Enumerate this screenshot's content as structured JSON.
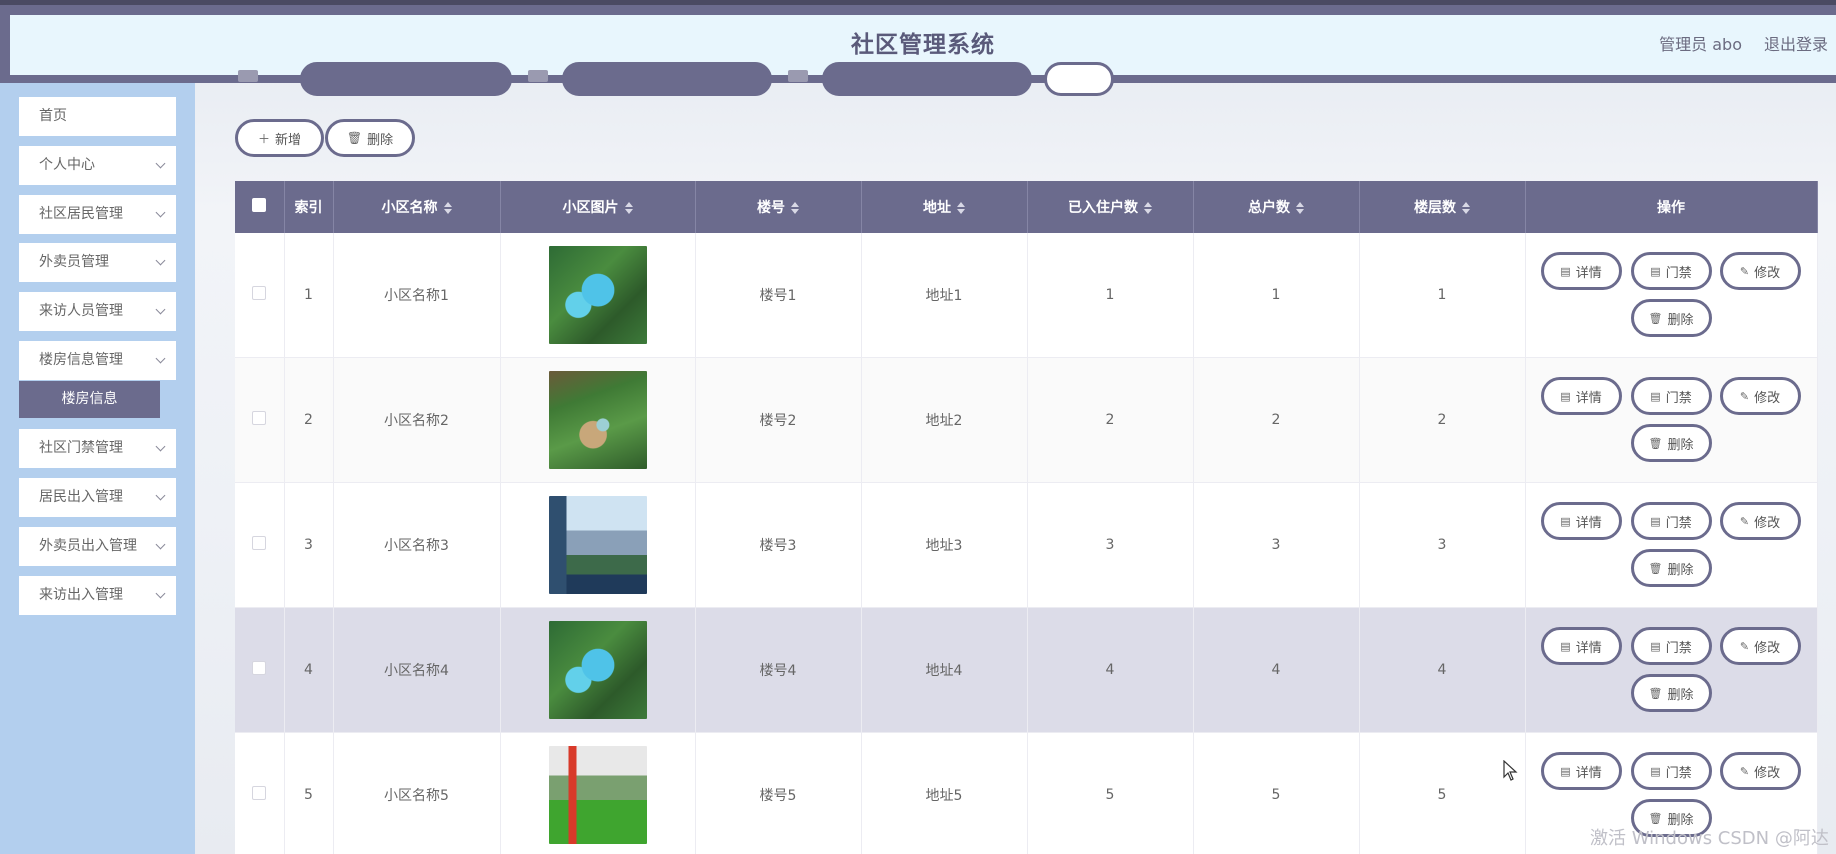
{
  "header": {
    "title": "社区管理系统",
    "user": "管理员 abo",
    "logout": "退出登录"
  },
  "sidebar": {
    "items": [
      "首页",
      "个人中心",
      "社区居民管理",
      "外卖员管理",
      "来访人员管理",
      "楼房信息管理",
      "社区门禁管理",
      "居民出入管理",
      "外卖员出入管理",
      "来访出入管理"
    ],
    "active_sub": "楼房信息"
  },
  "toolbar": {
    "add": "新增",
    "delete": "删除"
  },
  "table": {
    "headers": [
      "索引",
      "小区名称",
      "小区图片",
      "楼号",
      "地址",
      "已入住户数",
      "总户数",
      "楼层数",
      "操作"
    ],
    "rows": [
      {
        "index": "1",
        "name": "小区名称1",
        "building": "楼号1",
        "address": "地址1",
        "occupied": "1",
        "total": "1",
        "floors": "1"
      },
      {
        "index": "2",
        "name": "小区名称2",
        "building": "楼号2",
        "address": "地址2",
        "occupied": "2",
        "total": "2",
        "floors": "2"
      },
      {
        "index": "3",
        "name": "小区名称3",
        "building": "楼号3",
        "address": "地址3",
        "occupied": "3",
        "total": "3",
        "floors": "3"
      },
      {
        "index": "4",
        "name": "小区名称4",
        "building": "楼号4",
        "address": "地址4",
        "occupied": "4",
        "total": "4",
        "floors": "4"
      },
      {
        "index": "5",
        "name": "小区名称5",
        "building": "楼号5",
        "address": "地址5",
        "occupied": "5",
        "total": "5",
        "floors": "5"
      }
    ],
    "actions": {
      "detail": "详情",
      "access": "门禁",
      "edit": "修改",
      "delete": "删除"
    }
  },
  "watermark": "激活 Windows  CSDN @阿达学长",
  "colors": {
    "primary": "#6b6b8d",
    "sidebar": "#b3cfee",
    "header_bg": "#e8f6fd",
    "row_highlight": "#dcdce8"
  },
  "icons": {
    "add": "plus-icon",
    "delete": "trash-icon",
    "detail": "document-icon",
    "access": "document-icon",
    "edit": "pencil-icon",
    "menu_expand": "chevron-down-icon"
  }
}
